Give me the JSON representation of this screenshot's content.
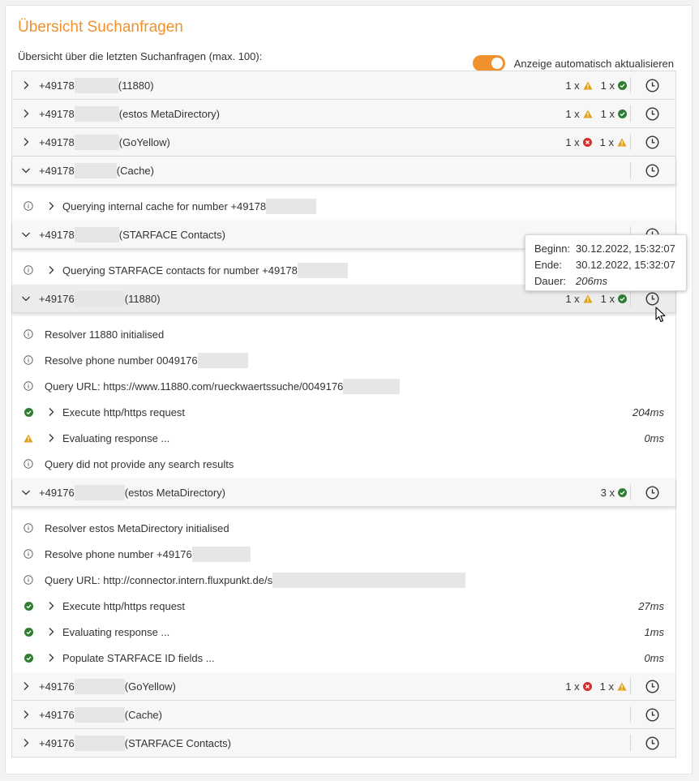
{
  "page": {
    "title": "Übersicht Suchanfragen",
    "subtitle": "Übersicht über die letzten Suchanfragen (max. 100):",
    "auto_refresh_label": "Anzeige automatisch aktualisieren",
    "auto_refresh_on": true
  },
  "colors": {
    "accent": "#f0912e",
    "ok": "#2e7d32",
    "warn": "#e0a21a",
    "error": "#d32f2f"
  },
  "rows": [
    {
      "prefix": "+49178",
      "source": "(11880)",
      "expanded": false,
      "stats": [
        {
          "count": "1 x",
          "icon": "warning-icon"
        },
        {
          "count": "1 x",
          "icon": "success-icon"
        }
      ]
    },
    {
      "prefix": "+49178",
      "source": "(estos MetaDirectory)",
      "expanded": false,
      "stats": [
        {
          "count": "1 x",
          "icon": "warning-icon"
        },
        {
          "count": "1 x",
          "icon": "success-icon"
        }
      ]
    },
    {
      "prefix": "+49178",
      "source": "(GoYellow)",
      "expanded": false,
      "stats": [
        {
          "count": "1 x",
          "icon": "error-icon"
        },
        {
          "count": "1 x",
          "icon": "warning-icon"
        }
      ]
    },
    {
      "prefix": "+49178",
      "source": "(Cache)",
      "expanded": true,
      "stats": [],
      "details": [
        {
          "icon": "info-icon",
          "chevron": true,
          "text": "Querying internal cache for number +49178",
          "redacted": true,
          "time": ""
        }
      ]
    },
    {
      "prefix": "+49178",
      "source": "(STARFACE Contacts)",
      "expanded": true,
      "stats": [],
      "details": [
        {
          "icon": "info-icon",
          "chevron": true,
          "text": "Querying STARFACE contacts for number +49178",
          "redacted": true,
          "time": ""
        }
      ]
    },
    {
      "prefix": "+49176",
      "source": "(11880)",
      "expanded": true,
      "hovered": true,
      "stats": [
        {
          "count": "1 x",
          "icon": "warning-icon"
        },
        {
          "count": "1 x",
          "icon": "success-icon"
        }
      ],
      "details": [
        {
          "icon": "info-icon",
          "chevron": false,
          "text": "Resolver 11880 initialised",
          "redacted": false,
          "time": ""
        },
        {
          "icon": "info-icon",
          "chevron": false,
          "text": "Resolve phone number 0049176",
          "redacted": true,
          "time": ""
        },
        {
          "icon": "info-icon",
          "chevron": false,
          "text": "Query URL: https://www.11880.com/rueckwaertssuche/0049176",
          "redacted": true,
          "time": ""
        },
        {
          "icon": "success-icon",
          "chevron": true,
          "text": "Execute http/https request",
          "redacted": false,
          "time": "204ms"
        },
        {
          "icon": "warning-icon",
          "chevron": true,
          "text": "Evaluating response ...",
          "redacted": false,
          "time": "0ms"
        },
        {
          "icon": "info-icon",
          "chevron": false,
          "text": "Query did not provide any search results",
          "redacted": false,
          "time": ""
        }
      ]
    },
    {
      "prefix": "+49176",
      "source": "(estos MetaDirectory)",
      "expanded": true,
      "stats": [
        {
          "count": "3 x",
          "icon": "success-icon"
        }
      ],
      "details": [
        {
          "icon": "info-icon",
          "chevron": false,
          "text": "Resolver estos MetaDirectory initialised",
          "redacted": false,
          "time": ""
        },
        {
          "icon": "info-icon",
          "chevron": false,
          "text": "Resolve phone number +49176",
          "redacted": true,
          "time": ""
        },
        {
          "icon": "info-icon",
          "chevron": false,
          "text": "Query URL: http://connector.intern.fluxpunkt.de/s",
          "redacted": true,
          "time": ""
        },
        {
          "icon": "success-icon",
          "chevron": true,
          "text": "Execute http/https request",
          "redacted": false,
          "time": "27ms"
        },
        {
          "icon": "success-icon",
          "chevron": true,
          "text": "Evaluating response ...",
          "redacted": false,
          "time": "1ms"
        },
        {
          "icon": "success-icon",
          "chevron": true,
          "text": "Populate STARFACE ID fields ...",
          "redacted": false,
          "time": "0ms"
        }
      ]
    },
    {
      "prefix": "+49176",
      "source": "(GoYellow)",
      "expanded": false,
      "stats": [
        {
          "count": "1 x",
          "icon": "error-icon"
        },
        {
          "count": "1 x",
          "icon": "warning-icon"
        }
      ]
    },
    {
      "prefix": "+49176",
      "source": "(Cache)",
      "expanded": false,
      "stats": []
    },
    {
      "prefix": "+49176",
      "source": "(STARFACE Contacts)",
      "expanded": false,
      "stats": []
    }
  ],
  "tooltip": {
    "begin_label": "Beginn:",
    "begin_value": "30.12.2022, 15:32:07",
    "end_label": "Ende:",
    "end_value": "30.12.2022, 15:32:07",
    "duration_label": "Dauer:",
    "duration_value": "206ms"
  }
}
